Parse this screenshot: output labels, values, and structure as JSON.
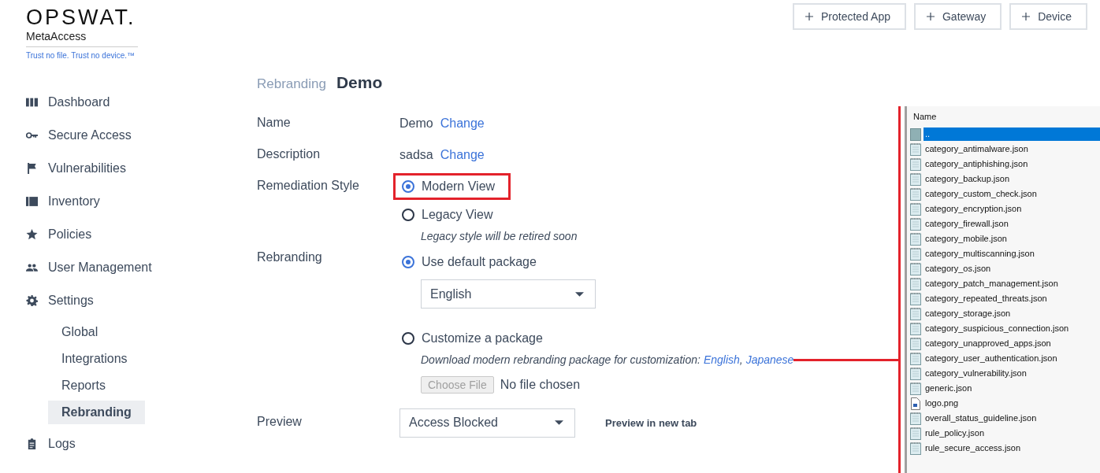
{
  "brand": {
    "logo": "OPSWAT.",
    "product": "MetaAccess",
    "tagline": "Trust no file. Trust no device.™"
  },
  "header_buttons": [
    "Protected App",
    "Gateway",
    "Device"
  ],
  "sidebar": {
    "items": [
      {
        "label": "Dashboard",
        "selected": false
      },
      {
        "label": "Secure Access",
        "selected": false
      },
      {
        "label": "Vulnerabilities",
        "selected": false
      },
      {
        "label": "Inventory",
        "selected": false
      },
      {
        "label": "Policies",
        "selected": false
      },
      {
        "label": "User Management",
        "selected": false
      },
      {
        "label": "Settings",
        "selected": false,
        "children": [
          {
            "label": "Global",
            "selected": false
          },
          {
            "label": "Integrations",
            "selected": false
          },
          {
            "label": "Reports",
            "selected": false
          },
          {
            "label": "Rebranding",
            "selected": true
          }
        ]
      },
      {
        "label": "Logs",
        "selected": false
      }
    ]
  },
  "breadcrumb": {
    "parent": "Rebranding",
    "current": "Demo"
  },
  "form": {
    "name": {
      "label": "Name",
      "value": "Demo",
      "action": "Change"
    },
    "description": {
      "label": "Description",
      "value": "sadsa",
      "action": "Change"
    },
    "remediation_style": {
      "label": "Remediation Style",
      "options": [
        {
          "label": "Modern View",
          "selected": true,
          "highlighted": true
        },
        {
          "label": "Legacy View",
          "selected": false,
          "highlighted": false
        }
      ],
      "hint": "Legacy style will be retired soon"
    },
    "rebranding": {
      "label": "Rebranding",
      "default_option": {
        "label": "Use default package",
        "selected": true
      },
      "language": "English",
      "custom_option": {
        "label": "Customize a package",
        "selected": false
      },
      "download_text": "Download modern rebranding package for customization:",
      "download_links": [
        "English",
        "Japanese"
      ],
      "download_separator": ",",
      "choose_file": "Choose File",
      "file_status": "No file chosen"
    },
    "preview": {
      "label": "Preview",
      "value": "Access Blocked",
      "link": "Preview in new tab"
    }
  },
  "file_panel": {
    "column": "Name",
    "files": [
      {
        "name": "..",
        "kind": "folder",
        "selected": true
      },
      {
        "name": "category_antimalware.json",
        "kind": "json",
        "selected": false
      },
      {
        "name": "category_antiphishing.json",
        "kind": "json",
        "selected": false
      },
      {
        "name": "category_backup.json",
        "kind": "json",
        "selected": false
      },
      {
        "name": "category_custom_check.json",
        "kind": "json",
        "selected": false
      },
      {
        "name": "category_encryption.json",
        "kind": "json",
        "selected": false
      },
      {
        "name": "category_firewall.json",
        "kind": "json",
        "selected": false
      },
      {
        "name": "category_mobile.json",
        "kind": "json",
        "selected": false
      },
      {
        "name": "category_multiscanning.json",
        "kind": "json",
        "selected": false
      },
      {
        "name": "category_os.json",
        "kind": "json",
        "selected": false
      },
      {
        "name": "category_patch_management.json",
        "kind": "json",
        "selected": false
      },
      {
        "name": "category_repeated_threats.json",
        "kind": "json",
        "selected": false
      },
      {
        "name": "category_storage.json",
        "kind": "json",
        "selected": false
      },
      {
        "name": "category_suspicious_connection.json",
        "kind": "json",
        "selected": false
      },
      {
        "name": "category_unapproved_apps.json",
        "kind": "json",
        "selected": false
      },
      {
        "name": "category_user_authentication.json",
        "kind": "json",
        "selected": false
      },
      {
        "name": "category_vulnerability.json",
        "kind": "json",
        "selected": false
      },
      {
        "name": "generic.json",
        "kind": "json",
        "selected": false
      },
      {
        "name": "logo.png",
        "kind": "image",
        "selected": false
      },
      {
        "name": "overall_status_guideline.json",
        "kind": "json",
        "selected": false
      },
      {
        "name": "rule_policy.json",
        "kind": "json",
        "selected": false
      },
      {
        "name": "rule_secure_access.json",
        "kind": "json",
        "selected": false
      }
    ]
  }
}
